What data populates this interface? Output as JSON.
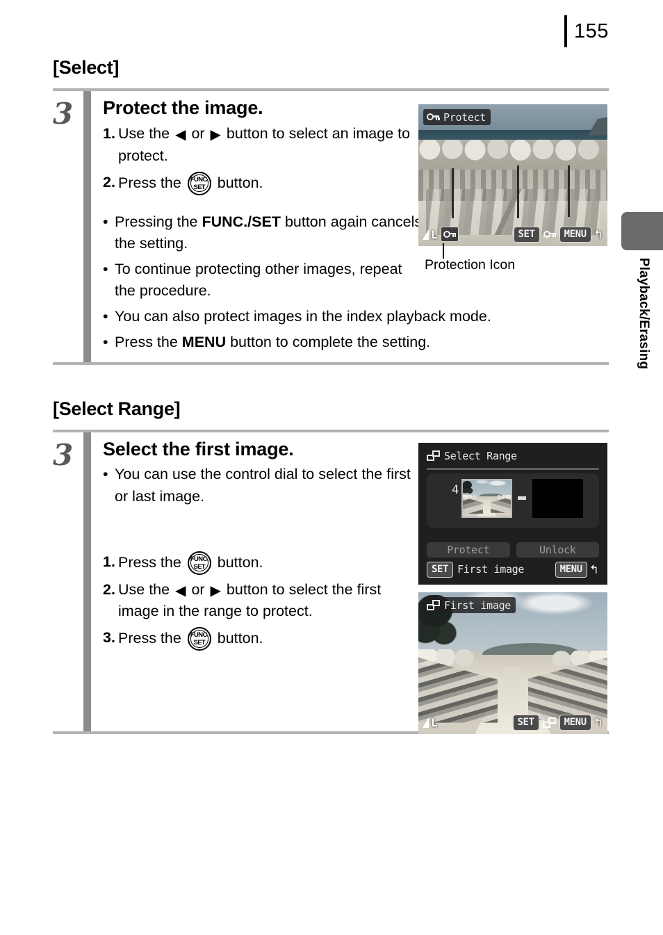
{
  "page": {
    "number": "155"
  },
  "side_tab": {
    "label": "Playback/Erasing"
  },
  "sections": [
    {
      "title": "[Select]",
      "step_number": "3",
      "heading": "Protect the image.",
      "numbered": [
        {
          "n": "1.",
          "before": "Use the ",
          "mid": " or ",
          "after": " button to select an image to protect."
        },
        {
          "n": "2.",
          "before": "Press the ",
          "after": " button."
        }
      ],
      "bullets": [
        {
          "pre": "Pressing the ",
          "bold": "FUNC./SET",
          "post": " button again cancels the setting."
        },
        {
          "pre": "To continue protecting other images, repeat the procedure.",
          "bold": "",
          "post": ""
        },
        {
          "pre": "You can also protect images in the index playback mode.",
          "bold": "",
          "post": ""
        },
        {
          "pre": "Press the ",
          "bold": "MENU",
          "post": " button to complete the setting."
        }
      ]
    },
    {
      "title": "[Select Range]",
      "step_number": "3",
      "heading": "Select the first image.",
      "bullets": [
        {
          "pre": "You can use the control dial to select the first or last image.",
          "bold": "",
          "post": ""
        }
      ],
      "numbered": [
        {
          "n": "1.",
          "before": "Press the ",
          "after": " button."
        },
        {
          "n": "2.",
          "before": "Use the ",
          "mid": " or ",
          "after": " button to select the first image in the range to protect."
        },
        {
          "n": "3.",
          "before": "Press the ",
          "after": " button."
        }
      ]
    }
  ],
  "screens": {
    "protect": {
      "title": "Protect",
      "title_icon": "key-icon",
      "quality": "L",
      "badge_icon": "key-icon",
      "set_chip": "SET",
      "action_icon": "key-icon",
      "menu_chip": "MENU",
      "return_glyph": "↰"
    },
    "select_range": {
      "title": "Select Range",
      "title_icon": "range-icon",
      "index": "4",
      "protect_button": "Protect",
      "unlock_button": "Unlock",
      "set_chip": "SET",
      "footer_text": "First image",
      "menu_chip": "MENU",
      "return_glyph": "↰"
    },
    "first_image": {
      "title": "First image",
      "title_icon": "range-icon",
      "quality": "L",
      "set_chip": "SET",
      "action_icon": "range-icon",
      "menu_chip": "MENU",
      "return_glyph": "↰"
    }
  },
  "callouts": {
    "protection_icon": "Protection Icon"
  },
  "glyphs": {
    "left_arrow": "◀",
    "right_arrow": "▶",
    "funcset_top": "FUNC.",
    "funcset_bottom": "SET",
    "bullet": "•"
  }
}
